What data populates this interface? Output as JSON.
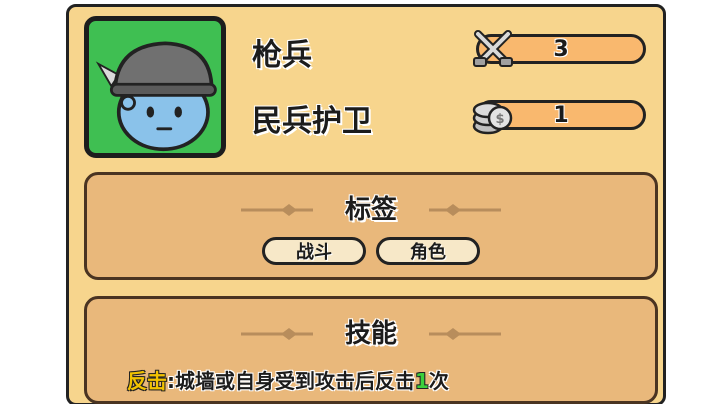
{
  "unit": {
    "name": "枪兵",
    "subtitle": "民兵护卫",
    "portrait_icon": "spearman-portrait-icon",
    "portrait_bg_color": "#3fbf52"
  },
  "stats": {
    "attack": {
      "icon": "crossed-swords-icon",
      "value": "3"
    },
    "cost": {
      "icon": "coin-stack-icon",
      "value": "1"
    }
  },
  "tags_panel": {
    "title": "标签",
    "tags": [
      "战斗",
      "角色"
    ]
  },
  "skills_panel": {
    "title": "技能",
    "skill": {
      "name": "反击",
      "separator": ":",
      "description": "城墙或自身受到攻击后反击",
      "count": "1",
      "suffix": "次"
    }
  },
  "colors": {
    "card_bg": "#f7d58d",
    "panel_bg": "#e9b87b",
    "stat_bar": "#f9b86e",
    "skill_name": "#f2c200",
    "skill_count": "#3ccf3c"
  }
}
